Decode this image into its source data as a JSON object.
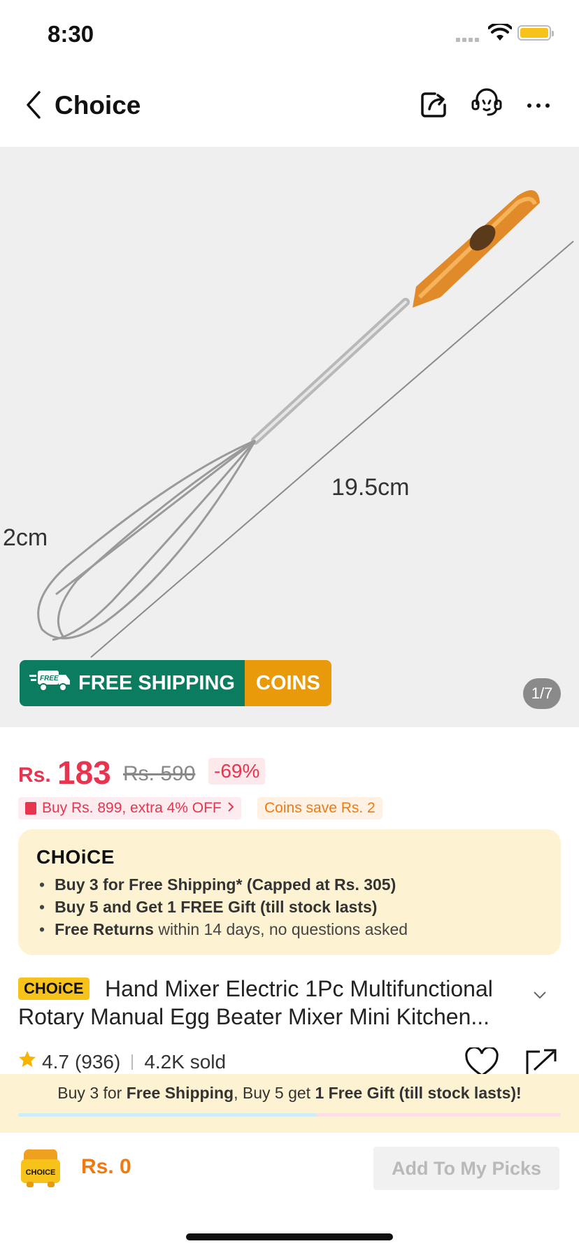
{
  "status_bar": {
    "time": "8:30"
  },
  "nav": {
    "title": "Choice"
  },
  "gallery": {
    "dimension_long": "19.5cm",
    "dimension_short": "2cm",
    "free_label": "FREE",
    "banner_shipping": "FREE SHIPPING",
    "banner_coins": "COINS",
    "counter": "1/7"
  },
  "price": {
    "currency": "Rs.",
    "value": "183",
    "original": "Rs. 590",
    "discount": "-69%"
  },
  "promos": {
    "buy_tag": "Buy Rs. 899, extra 4% OFF",
    "coins_tag": "Coins save Rs. 2"
  },
  "choice_card": {
    "logo": "CHOiCE",
    "bullet1": "Buy 3 for  Free Shipping* (Capped at Rs. 305)",
    "bullet2": "Buy 5 and Get 1 FREE Gift (till stock lasts)",
    "bullet3_bold": "Free Returns",
    "bullet3_rest": " within 14 days, no questions asked"
  },
  "product": {
    "badge": "CHOiCE",
    "title": "Hand Mixer Electric 1Pc Multifunctional Rotary Manual Egg Beater Mixer Mini Kitchen...",
    "rating": "4.7",
    "reviews": "(936)",
    "sold": "4.2K sold"
  },
  "promo_strip": {
    "text_a": "Buy 3 for ",
    "text_b": "Free Shipping",
    "text_c": ", Buy 5 get ",
    "text_d": "1 Free Gift (till stock lasts)!",
    "progress": 0.55
  },
  "bottom_bar": {
    "cart_label": "CHOICE",
    "amount": "Rs. 0",
    "add_button": "Add To My Picks"
  },
  "colors": {
    "price_red": "#e8344e",
    "choice_yellow": "#f7c31a",
    "shipping_green": "#0b7c5f",
    "coins_orange": "#e89a0a"
  }
}
